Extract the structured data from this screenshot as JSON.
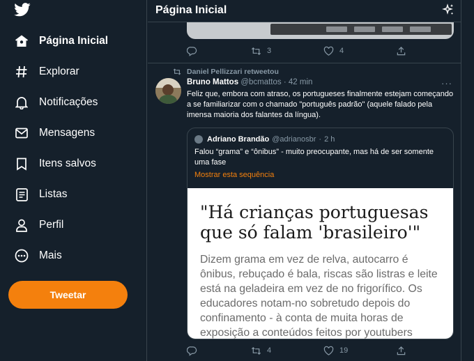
{
  "sidebar": {
    "logo_icon": "twitter-bird-icon",
    "items": [
      {
        "label": "Página Inicial",
        "icon": "home-icon",
        "active": true
      },
      {
        "label": "Explorar",
        "icon": "hashtag-icon",
        "active": false
      },
      {
        "label": "Notificações",
        "icon": "bell-icon",
        "active": false
      },
      {
        "label": "Mensagens",
        "icon": "envelope-icon",
        "active": false
      },
      {
        "label": "Itens salvos",
        "icon": "bookmark-icon",
        "active": false
      },
      {
        "label": "Listas",
        "icon": "list-icon",
        "active": false
      },
      {
        "label": "Perfil",
        "icon": "person-icon",
        "active": false
      },
      {
        "label": "Mais",
        "icon": "more-circle-icon",
        "active": false
      }
    ],
    "tweet_button": "Tweetar"
  },
  "header": {
    "title": "Página Inicial",
    "icon": "sparkle-icon"
  },
  "previous_tweet": {
    "retweets": "3",
    "likes": "4"
  },
  "tweet": {
    "retweeted_by": "Daniel Pellizzari retweetou",
    "author_name": "Bruno Mattos",
    "author_handle": "@bcmattos",
    "separator": "·",
    "time": "42 min",
    "more": "···",
    "text": "Feliz que, embora com atraso, os portugueses finalmente estejam começando a se familiarizar com o chamado \"português padrão\" (aquele falado pela imensa maioria dos falantes da língua).",
    "retweets": "4",
    "likes": "19",
    "quote": {
      "author_name": "Adriano Brandão",
      "author_handle": "@adrianosbr",
      "separator": "·",
      "time": "2 h",
      "text": "Falou “grama” e “ônibus” - muito preocupante, mas há de ser somente uma fase",
      "show_thread": "Mostrar esta sequência",
      "article_title": "\"Há crianças portuguesas que só falam 'brasileiro'\"",
      "article_body": "Dizem grama em vez de relva, autocarro é ônibus, rebuçado é bala, riscas são listras e leite está na geladeira em vez de no frigorífico. Os educadores notam-no sobretudo depois do confinamento - à conta de muita horas de exposição a conteúdos feitos por youtubers"
    }
  },
  "colors": {
    "background": "#15202b",
    "border": "#38444d",
    "muted": "#8899a6",
    "accent": "#f4800d"
  }
}
